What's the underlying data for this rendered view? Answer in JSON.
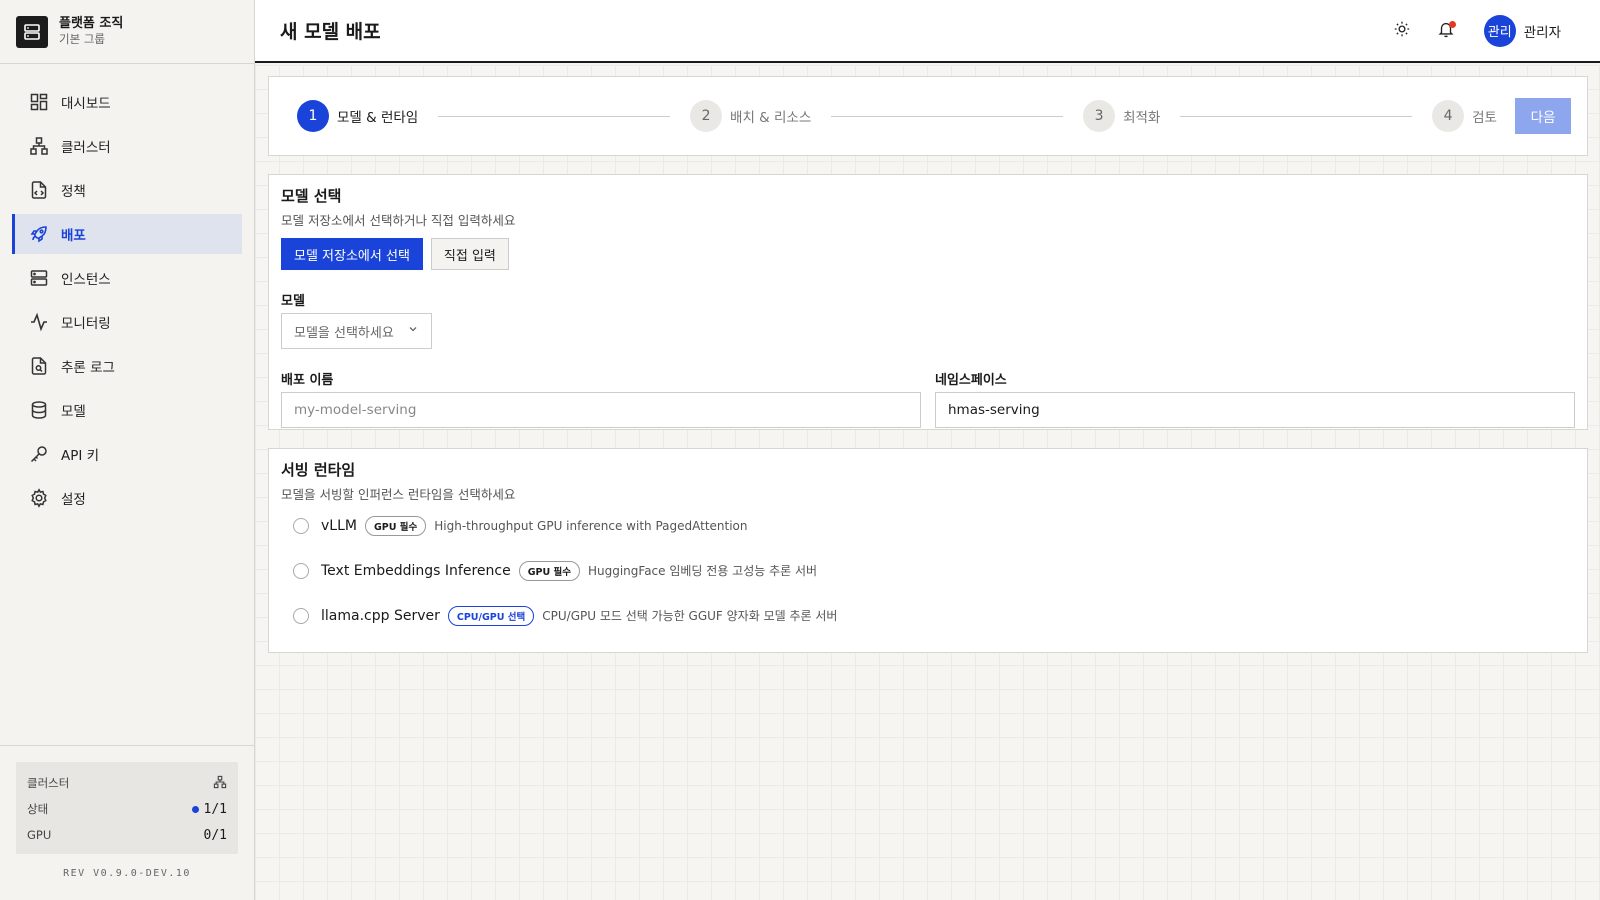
{
  "sidebar": {
    "org_name": "플랫폼 조직",
    "org_sub": "기본 그룹",
    "items": [
      {
        "label": "대시보드",
        "icon": "grid-icon"
      },
      {
        "label": "클러스터",
        "icon": "cluster-icon"
      },
      {
        "label": "정책",
        "icon": "policy-icon"
      },
      {
        "label": "배포",
        "icon": "rocket-icon",
        "active": true
      },
      {
        "label": "인스턴스",
        "icon": "server-icon"
      },
      {
        "label": "모니터링",
        "icon": "activity-icon"
      },
      {
        "label": "추론 로그",
        "icon": "log-icon"
      },
      {
        "label": "모델",
        "icon": "database-icon"
      },
      {
        "label": "API 키",
        "icon": "key-icon"
      },
      {
        "label": "설정",
        "icon": "gear-icon"
      }
    ],
    "cluster_box": {
      "title": "클러스터",
      "status_label": "상태",
      "status_value": "1/1",
      "gpu_label": "GPU",
      "gpu_value": "0/1"
    },
    "revision": "REV V0.9.0-DEV.10"
  },
  "header": {
    "title": "새 모델 배포",
    "avatar_text": "관리",
    "user_name": "관리자"
  },
  "stepper": {
    "steps": [
      {
        "num": "1",
        "label": "모델 & 런타임",
        "active": true
      },
      {
        "num": "2",
        "label": "배치 & 리소스"
      },
      {
        "num": "3",
        "label": "최적화"
      },
      {
        "num": "4",
        "label": "검토"
      }
    ],
    "next_label": "다음"
  },
  "model_section": {
    "title": "모델 선택",
    "description": "모델 저장소에서 선택하거나 직접 입력하세요",
    "tab_repo": "모델 저장소에서 선택",
    "tab_manual": "직접 입력",
    "model_label": "모델",
    "model_placeholder": "모델을 선택하세요",
    "deploy_name_label": "배포 이름",
    "deploy_name_placeholder": "my-model-serving",
    "namespace_label": "네임스페이스",
    "namespace_value": "hmas-serving"
  },
  "runtime_section": {
    "title": "서빙 런타임",
    "description": "모델을 서빙할 인퍼런스 런타임을 선택하세요",
    "options": [
      {
        "name": "vLLM",
        "badge": "GPU 필수",
        "desc": "High-throughput GPU inference with PagedAttention"
      },
      {
        "name": "Text Embeddings Inference",
        "badge": "GPU 필수",
        "desc": "HuggingFace 임베딩 전용 고성능 추론 서버"
      },
      {
        "name": "llama.cpp Server",
        "badge": "CPU/GPU 선택",
        "desc": "CPU/GPU 모드 선택 가능한 GGUF 양자화 모델 추론 서버"
      }
    ]
  },
  "colors": {
    "accent": "#1a43d9",
    "next_disabled": "#8ea6ee",
    "notification": "#e5381f"
  }
}
